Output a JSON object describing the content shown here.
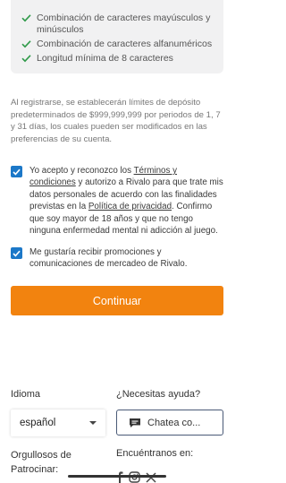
{
  "requirements": [
    "Combinación de caracteres mayúsculos y minúsculos",
    "Combinación de caracteres alfanuméricos",
    "Longitud mínima de 8 caracteres"
  ],
  "notice": "Al registrarse, se establecerán límites de depósito predeterminados de $999,999,999 por periodos de 1, 7 y 31 días, los cuales pueden ser modificados en las preferencias de su cuenta.",
  "terms": {
    "p1": "Yo acepto y reconozco los ",
    "link1": "Términos y condiciones",
    "p2": " y autorizo a Rivalo para que trate mis datos personales de acuerdo con las finalidades previstas en la ",
    "link2": "Política de privacidad",
    "p3": ". Confirmo que soy mayor de 18 años y que no tengo ninguna enfermedad mental ni adicción al juego.",
    "checked": true
  },
  "promo": {
    "text": "Me gustaría recibir promociones y comunicaciones de mercadeo de Rivalo.",
    "checked": true
  },
  "cta_label": "Continuar",
  "footer": {
    "language_label": "Idioma",
    "language_value": "español",
    "help_label": "¿Necesitas ayuda?",
    "chat_label": "Chatea co...",
    "sponsor_label_line1": "Orgullosos de",
    "sponsor_label_line2": "Patrocinar:",
    "find_us_label": "Encuéntranos en:"
  },
  "social_icons": [
    "facebook-icon",
    "instagram-icon",
    "x-icon"
  ],
  "colors": {
    "accent": "#f2830f",
    "checkbox": "#1c78c8",
    "check_green": "#2f9a49"
  }
}
